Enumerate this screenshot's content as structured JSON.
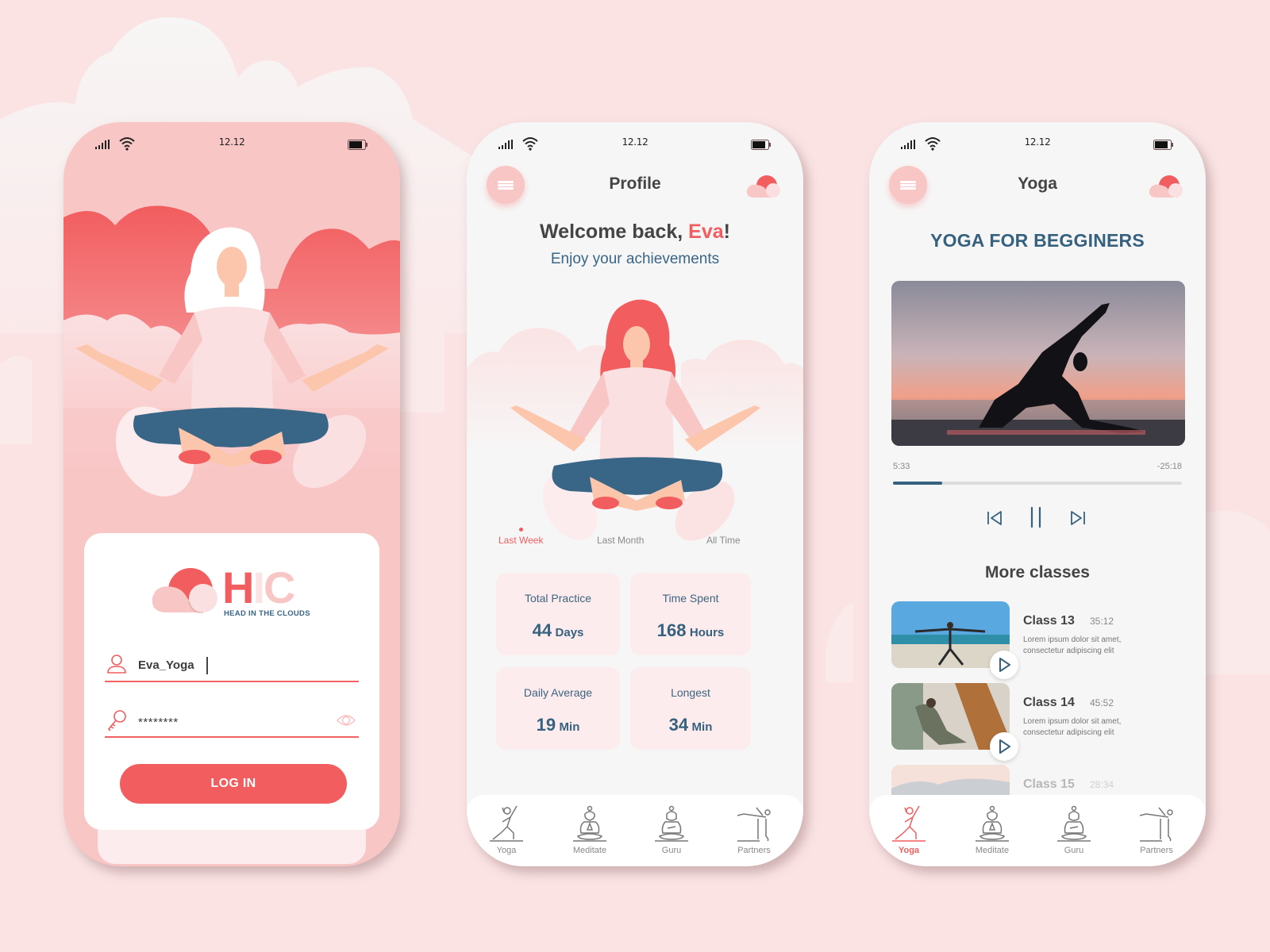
{
  "status_bar": {
    "time": "12.12"
  },
  "login_screen": {
    "logo": {
      "letters": [
        "H",
        "I",
        "C"
      ],
      "tagline": "HEAD IN THE CLOUDS"
    },
    "username": {
      "value": "Eva_Yoga"
    },
    "password": {
      "value": "********"
    },
    "login_button": "LOG IN"
  },
  "profile_screen": {
    "title": "Profile",
    "welcome_prefix": "Welcome back, ",
    "user_name": "Eva",
    "welcome_suffix": "!",
    "subtitle": "Enjoy your achievements",
    "period_tabs": [
      {
        "label": "Last Week",
        "active": true
      },
      {
        "label": "Last Month",
        "active": false
      },
      {
        "label": "All Time",
        "active": false
      }
    ],
    "stats": [
      {
        "label": "Total Practice",
        "value": "44",
        "unit": "Days"
      },
      {
        "label": "Time Spent",
        "value": "168",
        "unit": "Hours"
      },
      {
        "label": "Daily Average",
        "value": "19",
        "unit": "Min"
      },
      {
        "label": "Longest",
        "value": "34",
        "unit": "Min"
      }
    ]
  },
  "yoga_screen": {
    "title": "Yoga",
    "heading": "YOGA FOR BEGGINERS",
    "player": {
      "elapsed": "5:33",
      "remaining": "-25:18",
      "progress_fraction": 0.17
    },
    "more_title": "More classes",
    "classes": [
      {
        "name": "Class 13",
        "duration": "35:12",
        "description": "Lorem ipsum dolor sit amet, consectetur adipiscing elit"
      },
      {
        "name": "Class 14",
        "duration": "45:52",
        "description": "Lorem ipsum dolor sit amet, consectetur adipiscing elit"
      },
      {
        "name": "Class 15",
        "duration": "28:34",
        "description": ""
      }
    ]
  },
  "bottom_nav": [
    {
      "label": "Yoga",
      "icon": "yoga-pose-icon"
    },
    {
      "label": "Meditate",
      "icon": "meditate-icon"
    },
    {
      "label": "Guru",
      "icon": "guru-icon"
    },
    {
      "label": "Partners",
      "icon": "partners-icon"
    }
  ],
  "colors": {
    "accent": "#f25d5f",
    "primary_blue": "#36617f",
    "pink_light": "#f9c6c6",
    "background": "#fbe3e4"
  }
}
